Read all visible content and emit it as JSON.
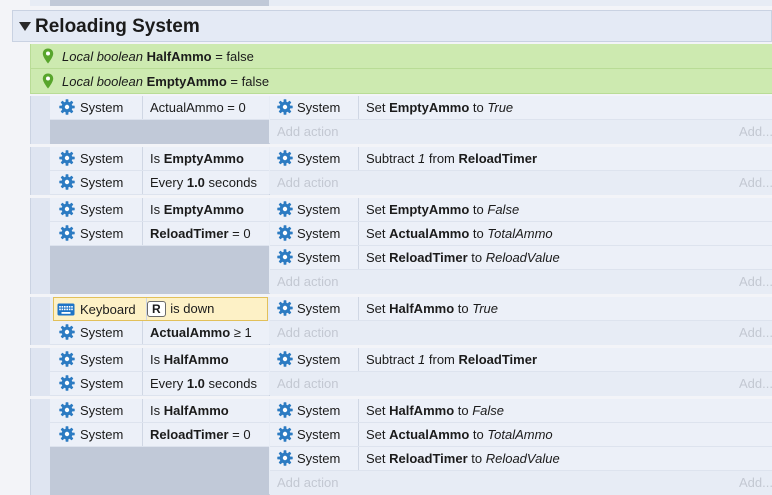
{
  "colors": {
    "background": "#f3f4f8",
    "group_header_bg": "#e4eaf5",
    "local_var_bg": "#cdeab0",
    "event_row_bg": "#e7ecf5",
    "condition_gutter": "#c1c9d8",
    "highlight_bg": "#fdf1c6",
    "highlight_border": "#e2c05a",
    "gear_blue": "#2c7bc2",
    "location_pin": "#58a52c",
    "keyboard_blue": "#1e74c6"
  },
  "group": {
    "title": "Reloading System",
    "expander_icon": "triangle-down-icon"
  },
  "local_vars": [
    {
      "prefix": "Local boolean",
      "name": "HalfAmmo",
      "rest": " = false",
      "icon": "location-pin-icon"
    },
    {
      "prefix": "Local boolean",
      "name": "EmptyAmmo",
      "rest": " = false",
      "icon": "location-pin-icon"
    }
  ],
  "add_action_label": "Add action",
  "add_more_label": "Add...",
  "events": [
    {
      "conditions": [
        {
          "object": "System",
          "icon": "gear-icon",
          "parts": [
            {
              "t": "ActualAmmo = 0",
              "s": "n"
            }
          ]
        }
      ],
      "actions": [
        {
          "object": "System",
          "icon": "gear-icon",
          "parts": [
            {
              "t": "Set ",
              "s": "n"
            },
            {
              "t": "EmptyAmmo",
              "s": "b"
            },
            {
              "t": " to ",
              "s": "n"
            },
            {
              "t": "True",
              "s": "i"
            }
          ]
        }
      ]
    },
    {
      "conditions": [
        {
          "object": "System",
          "icon": "gear-icon",
          "parts": [
            {
              "t": "Is ",
              "s": "n"
            },
            {
              "t": "EmptyAmmo",
              "s": "b"
            }
          ]
        },
        {
          "object": "System",
          "icon": "gear-icon",
          "parts": [
            {
              "t": "Every ",
              "s": "n"
            },
            {
              "t": "1.0",
              "s": "b"
            },
            {
              "t": " seconds",
              "s": "n"
            }
          ]
        }
      ],
      "actions": [
        {
          "object": "System",
          "icon": "gear-icon",
          "parts": [
            {
              "t": "Subtract ",
              "s": "n"
            },
            {
              "t": "1",
              "s": "i"
            },
            {
              "t": " from ",
              "s": "n"
            },
            {
              "t": "ReloadTimer",
              "s": "b"
            }
          ]
        }
      ]
    },
    {
      "conditions": [
        {
          "object": "System",
          "icon": "gear-icon",
          "parts": [
            {
              "t": "Is ",
              "s": "n"
            },
            {
              "t": "EmptyAmmo",
              "s": "b"
            }
          ]
        },
        {
          "object": "System",
          "icon": "gear-icon",
          "parts": [
            {
              "t": "ReloadTimer",
              "s": "b"
            },
            {
              "t": " = 0",
              "s": "n"
            }
          ]
        }
      ],
      "actions": [
        {
          "object": "System",
          "icon": "gear-icon",
          "parts": [
            {
              "t": "Set ",
              "s": "n"
            },
            {
              "t": "EmptyAmmo",
              "s": "b"
            },
            {
              "t": " to ",
              "s": "n"
            },
            {
              "t": "False",
              "s": "i"
            }
          ]
        },
        {
          "object": "System",
          "icon": "gear-icon",
          "parts": [
            {
              "t": "Set ",
              "s": "n"
            },
            {
              "t": "ActualAmmo",
              "s": "b"
            },
            {
              "t": " to ",
              "s": "n"
            },
            {
              "t": "TotalAmmo",
              "s": "i"
            }
          ]
        },
        {
          "object": "System",
          "icon": "gear-icon",
          "parts": [
            {
              "t": "Set ",
              "s": "n"
            },
            {
              "t": "ReloadTimer",
              "s": "b"
            },
            {
              "t": " to ",
              "s": "n"
            },
            {
              "t": "ReloadValue",
              "s": "i"
            }
          ]
        }
      ]
    },
    {
      "conditions": [
        {
          "object": "Keyboard",
          "icon": "keyboard-icon",
          "highlighted": true,
          "key": "R",
          "parts": [
            {
              "t": " is down",
              "s": "n"
            }
          ]
        },
        {
          "object": "System",
          "icon": "gear-icon",
          "parts": [
            {
              "t": "ActualAmmo",
              "s": "b"
            },
            {
              "t": " ≥ 1",
              "s": "n"
            }
          ]
        }
      ],
      "actions": [
        {
          "object": "System",
          "icon": "gear-icon",
          "parts": [
            {
              "t": "Set ",
              "s": "n"
            },
            {
              "t": "HalfAmmo",
              "s": "b"
            },
            {
              "t": " to ",
              "s": "n"
            },
            {
              "t": "True",
              "s": "i"
            }
          ]
        }
      ]
    },
    {
      "conditions": [
        {
          "object": "System",
          "icon": "gear-icon",
          "parts": [
            {
              "t": "Is ",
              "s": "n"
            },
            {
              "t": "HalfAmmo",
              "s": "b"
            }
          ]
        },
        {
          "object": "System",
          "icon": "gear-icon",
          "parts": [
            {
              "t": "Every ",
              "s": "n"
            },
            {
              "t": "1.0",
              "s": "b"
            },
            {
              "t": " seconds",
              "s": "n"
            }
          ]
        }
      ],
      "actions": [
        {
          "object": "System",
          "icon": "gear-icon",
          "parts": [
            {
              "t": "Subtract ",
              "s": "n"
            },
            {
              "t": "1",
              "s": "i"
            },
            {
              "t": " from ",
              "s": "n"
            },
            {
              "t": "ReloadTimer",
              "s": "b"
            }
          ]
        }
      ]
    },
    {
      "conditions": [
        {
          "object": "System",
          "icon": "gear-icon",
          "parts": [
            {
              "t": "Is ",
              "s": "n"
            },
            {
              "t": "HalfAmmo",
              "s": "b"
            }
          ]
        },
        {
          "object": "System",
          "icon": "gear-icon",
          "parts": [
            {
              "t": "ReloadTimer",
              "s": "b"
            },
            {
              "t": " = 0",
              "s": "n"
            }
          ]
        }
      ],
      "actions": [
        {
          "object": "System",
          "icon": "gear-icon",
          "parts": [
            {
              "t": "Set ",
              "s": "n"
            },
            {
              "t": "HalfAmmo",
              "s": "b"
            },
            {
              "t": " to ",
              "s": "n"
            },
            {
              "t": "False",
              "s": "i"
            }
          ]
        },
        {
          "object": "System",
          "icon": "gear-icon",
          "parts": [
            {
              "t": "Set ",
              "s": "n"
            },
            {
              "t": "ActualAmmo",
              "s": "b"
            },
            {
              "t": " to ",
              "s": "n"
            },
            {
              "t": "TotalAmmo",
              "s": "i"
            }
          ]
        },
        {
          "object": "System",
          "icon": "gear-icon",
          "parts": [
            {
              "t": "Set ",
              "s": "n"
            },
            {
              "t": "ReloadTimer",
              "s": "b"
            },
            {
              "t": " to ",
              "s": "n"
            },
            {
              "t": "ReloadValue",
              "s": "i"
            }
          ]
        }
      ]
    }
  ]
}
